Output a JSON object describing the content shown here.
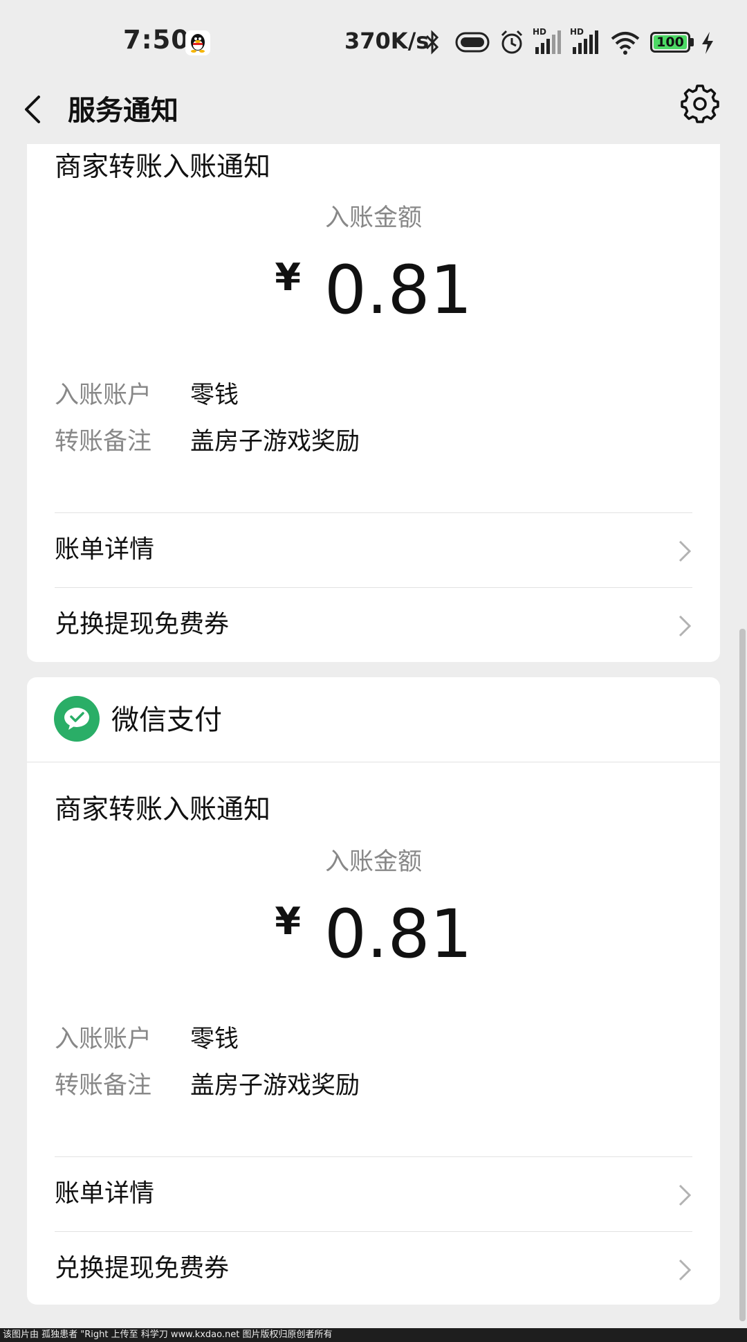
{
  "status_bar": {
    "time": "7:50",
    "network_speed": "370K/s",
    "battery_level": "100",
    "icons": [
      "qq-icon",
      "bluetooth-icon",
      "toggle-icon",
      "alarm-icon",
      "hd-signal-icon",
      "hd-signal-icon",
      "wifi-icon",
      "battery-icon",
      "charging-icon"
    ]
  },
  "nav": {
    "title": "服务通知"
  },
  "cards": [
    {
      "notice_title": "商家转账入账通知",
      "amount_label": "入账金额",
      "currency": "¥",
      "amount": "0.81",
      "account_label": "入账账户",
      "account_value": "零钱",
      "remark_label": "转账备注",
      "remark_value": "盖房子游戏奖励",
      "links": [
        "账单详情",
        "兑换提现免费券"
      ]
    },
    {
      "sender": "微信支付",
      "notice_title": "商家转账入账通知",
      "amount_label": "入账金额",
      "currency": "¥",
      "amount": "0.81",
      "account_label": "入账账户",
      "account_value": "零钱",
      "remark_label": "转账备注",
      "remark_value": "盖房子游戏奖励",
      "links": [
        "账单详情",
        "兑换提现免费券"
      ]
    }
  ],
  "watermark": "该图片由 孤独患者 \"Right 上传至 科学刀 www.kxdao.net 图片版权归原创者所有",
  "colors": {
    "background": "#ededed",
    "card": "#ffffff",
    "wechat_pay_green": "#2aae67",
    "secondary_text": "#888888"
  }
}
